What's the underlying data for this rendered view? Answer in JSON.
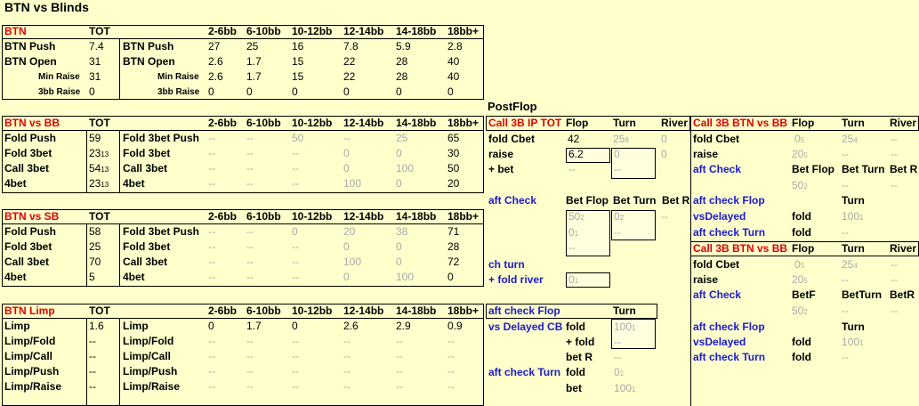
{
  "title": "BTN vs Blinds",
  "postflop_title": "PostFlop",
  "cols": [
    "2-6bb",
    "6-10bb",
    "10-12bb",
    "12-14bb",
    "14-18bb",
    "18bb+"
  ],
  "tot_label": "TOT",
  "btn": {
    "header": "BTN",
    "rows": [
      {
        "label": "BTN Push",
        "tot": "7.4",
        "label2": "BTN Push",
        "vals": [
          "27",
          "25",
          "16",
          "7.8",
          "5.9",
          "2.8"
        ],
        "small": false
      },
      {
        "label": "BTN Open",
        "tot": "31",
        "label2": "BTN Open",
        "vals": [
          "2.6",
          "1.7",
          "15",
          "22",
          "28",
          "40"
        ],
        "small": false
      },
      {
        "label": "Min Raise",
        "tot": "31",
        "label2": "Min Raise",
        "vals": [
          "2.6",
          "1.7",
          "15",
          "22",
          "28",
          "40"
        ],
        "small": true
      },
      {
        "label": "3bb Raise",
        "tot": "0",
        "label2": "3bb Raise",
        "vals": [
          "0",
          "0",
          "0",
          "0",
          "0",
          "0"
        ],
        "small": true
      }
    ]
  },
  "bb": {
    "header": "BTN vs BB",
    "rows": [
      {
        "label": "Fold Push",
        "tot": "59",
        "label2": "Fold 3bet Push",
        "vals": [
          "--",
          "--",
          "50",
          "--",
          "25",
          "65"
        ]
      },
      {
        "label": "Fold 3bet",
        "tot": "23",
        "tot_sub": "13",
        "label2": "Fold 3bet",
        "vals": [
          "--",
          "--",
          "--",
          "0",
          "0",
          "30"
        ]
      },
      {
        "label": "Call 3bet",
        "tot": "54",
        "tot_sub": "13",
        "label2": "Call 3bet",
        "vals": [
          "--",
          "--",
          "--",
          "0",
          "100",
          "50"
        ]
      },
      {
        "label": "4bet",
        "tot": "23",
        "tot_sub": "13",
        "label2": "4bet",
        "vals": [
          "--",
          "--",
          "--",
          "100",
          "0",
          "20"
        ]
      }
    ]
  },
  "sb": {
    "header": "BTN vs SB",
    "rows": [
      {
        "label": "Fold Push",
        "tot": "58",
        "label2": "Fold 3bet Push",
        "vals": [
          "--",
          "--",
          "0",
          "20",
          "38",
          "71"
        ]
      },
      {
        "label": "Fold 3bet",
        "tot": "25",
        "label2": "Fold 3bet",
        "vals": [
          "--",
          "--",
          "--",
          "0",
          "0",
          "28"
        ]
      },
      {
        "label": "Call 3bet",
        "tot": "70",
        "label2": "Call 3bet",
        "vals": [
          "--",
          "--",
          "--",
          "100",
          "0",
          "72"
        ]
      },
      {
        "label": "4bet",
        "tot": "5",
        "label2": "4bet",
        "vals": [
          "--",
          "--",
          "--",
          "0",
          "100",
          "0"
        ]
      }
    ]
  },
  "limp": {
    "header": "BTN Limp",
    "rows": [
      {
        "label": "Limp",
        "tot": "1.6",
        "label2": "Limp",
        "vals": [
          "0",
          "1.7",
          "0",
          "2.6",
          "2.9",
          "0.9"
        ]
      },
      {
        "label": "Limp/Fold",
        "tot": "--",
        "label2": "Limp/Fold",
        "vals": [
          "--",
          "--",
          "--",
          "--",
          "--",
          "--"
        ]
      },
      {
        "label": "Limp/Call",
        "tot": "--",
        "label2": "Limp/Call",
        "vals": [
          "--",
          "--",
          "--",
          "--",
          "--",
          "--"
        ]
      },
      {
        "label": "Limp/Push",
        "tot": "--",
        "label2": "Limp/Push",
        "vals": [
          "--",
          "--",
          "--",
          "--",
          "--",
          "--"
        ]
      },
      {
        "label": "Limp/Raise",
        "tot": "--",
        "label2": "Limp/Raise",
        "vals": [
          "--",
          "--",
          "--",
          "--",
          "--",
          "--"
        ]
      }
    ]
  },
  "ip": {
    "header": "Call 3B IP TOT",
    "col_flop": "Flop",
    "col_turn": "Turn",
    "col_river": "River",
    "fold_cbet": "fold Cbet",
    "fold_cbet_flop": "42",
    "fold_cbet_turn": "25",
    "fold_cbet_turn_sub": "8",
    "fold_cbet_river": "0",
    "raise": "raise",
    "raise_flop": "6.2",
    "raise_turn": "0",
    "raise_river": "0",
    "plus_bet": "+ bet",
    "plus_bet_flop": "--",
    "plus_bet_turn": "--",
    "aft_check": "aft Check",
    "bet_flop": "Bet Flop",
    "bet_turn": "Bet Turn",
    "bet_r": "Bet R",
    "ac_flop": "50",
    "ac_turn": "0",
    "ac_r": "--",
    "ac2_flop": "0",
    "ac2_turn": "--",
    "ac3_flop": "--",
    "ch_turn": "ch turn",
    "fold_river": "+ fold river",
    "fold_river_val": "0"
  },
  "acf": {
    "header": "aft check Flop",
    "col_turn": "Turn",
    "vs_delayed": "vs Delayed CB",
    "fold": "fold",
    "fold_val": "100",
    "plus_fold": "+ fold",
    "plus_fold_val": "--",
    "bet_r": "bet R",
    "bet_r_val": "--",
    "act": "aft check Turn",
    "act_fold": "fold",
    "act_fold_val": "0",
    "bet": "bet",
    "bet_val": "100"
  },
  "r1": {
    "header": "Call 3B BTN vs BB",
    "col_flop": "Flop",
    "col_turn": "Turn",
    "col_river": "River",
    "fold_cbet": "fold Cbet",
    "fc_flop": "0",
    "fc_turn": "25",
    "fc_river": "--",
    "raise": "raise",
    "r_flop": "20",
    "r_turn": "--",
    "r_river": "--",
    "aft_check": "aft Check",
    "bet_flop": "Bet Flop",
    "bet_turn": "Bet Turn",
    "bet_r": "Bet R",
    "ac_flop": "50",
    "ac_turn": "--",
    "ac_r": "--",
    "acf": "aft check Flop",
    "acf_turn": "Turn",
    "vsd": "vsDelayed",
    "vsd_fold": "fold",
    "vsd_val": "100",
    "act": "aft check Turn",
    "act_fold": "fold",
    "act_val": "--"
  },
  "r2": {
    "header": "Call 3B BTN vs BB",
    "col_flop": "Flop",
    "col_turn": "Turn",
    "col_river": "River",
    "fold_cbet": "fold Cbet",
    "fc_flop": "0",
    "fc_turn": "25",
    "fc_river": "--",
    "raise": "raise",
    "r_flop": "20",
    "r_turn": "--",
    "r_river": "--",
    "aft_check": "aft Check",
    "betf": "BetF",
    "betturn": "BetTurn",
    "betr": "BetR",
    "ac_flop": "50",
    "ac_turn": "--",
    "ac_r": "--",
    "acf": "aft check Flop",
    "acf_turn": "Turn",
    "vsd": "vsDelayed",
    "vsd_fold": "fold",
    "vsd_val": "100",
    "act": "aft check Turn",
    "act_fold": "fold",
    "act_val": "--"
  }
}
